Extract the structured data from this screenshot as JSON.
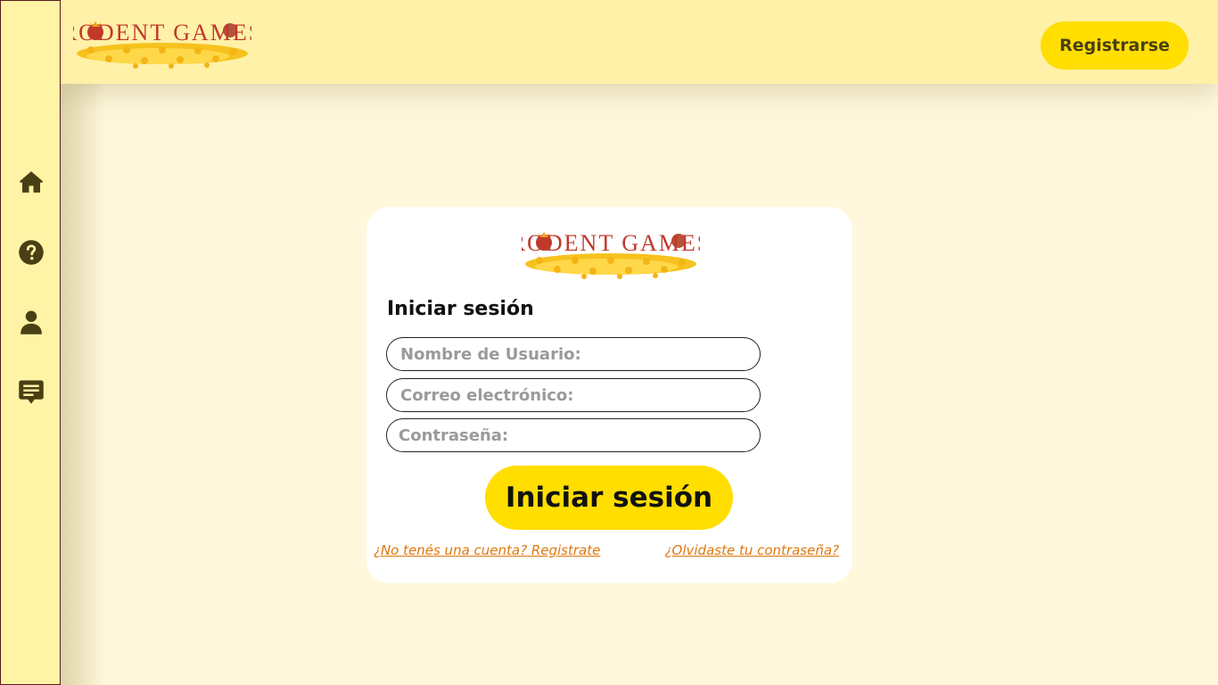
{
  "header": {
    "logo_text": "RODENT GAMES",
    "register_label": "Registrarse"
  },
  "sidebar": {
    "items": [
      {
        "icon": "home-icon"
      },
      {
        "icon": "help-icon"
      },
      {
        "icon": "user-icon"
      },
      {
        "icon": "chat-icon"
      }
    ]
  },
  "login": {
    "logo_text": "RODENT GAMES",
    "title": "Iniciar sesión",
    "username_placeholder": "Nombre de Usuario:",
    "email_placeholder": "Correo electrónico:",
    "password_placeholder": "Contraseña:",
    "submit_label": "Iniciar sesión",
    "register_link": "¿No tenés una cuenta? Registrate",
    "forgot_link": "¿Olvidaste tu contraseña?"
  },
  "colors": {
    "background": "#fff8dc",
    "header": "#fff1a8",
    "accent": "#ffde00",
    "link": "#e0770d",
    "logo_red": "#c0392b"
  }
}
